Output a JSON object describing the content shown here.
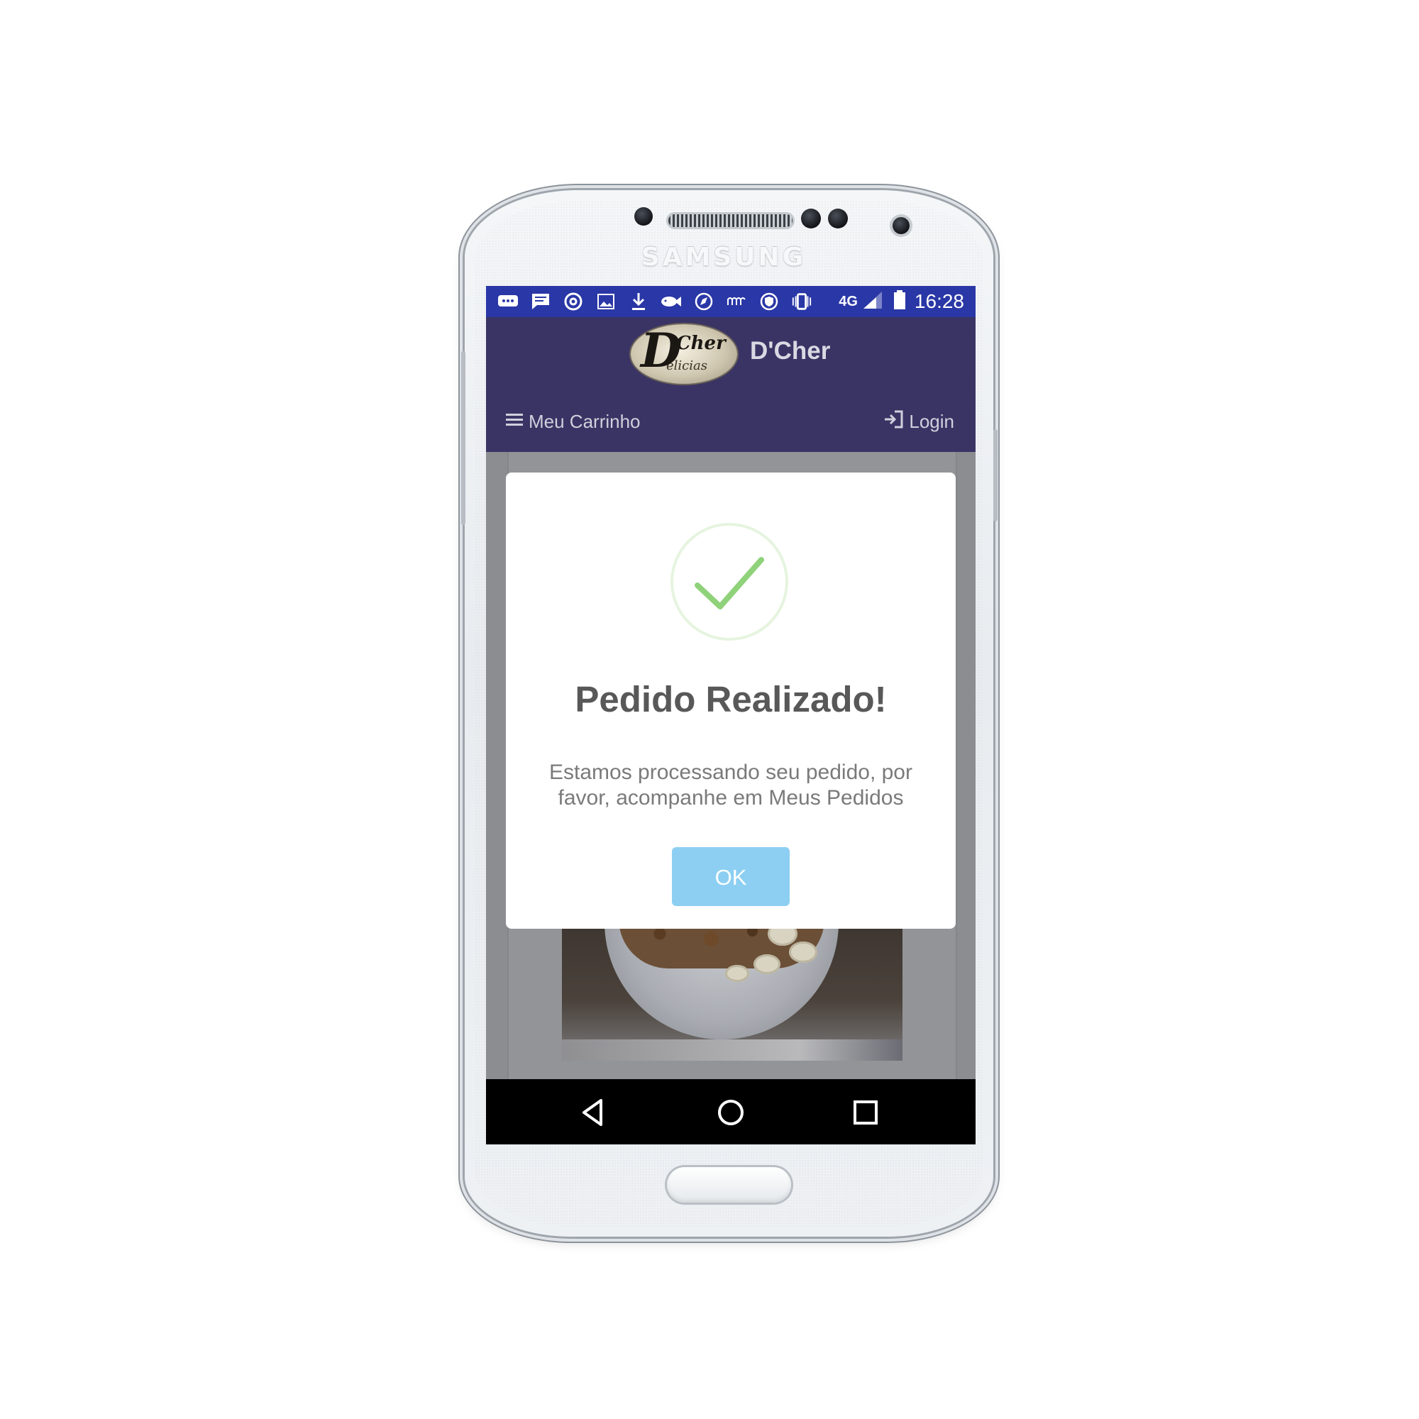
{
  "device": {
    "brand": "SAMSUNG"
  },
  "status_bar": {
    "icons": [
      "message-icon",
      "chat-icon",
      "at-icon",
      "image-icon",
      "download-icon",
      "fish-icon",
      "compass-icon",
      "wave-icon",
      "shield-icon",
      "vibrate-icon"
    ],
    "network": "4G",
    "time": "16:28",
    "color": "#2a37a6"
  },
  "app": {
    "title": "D'Cher",
    "logo_text_big": "D",
    "logo_text_top": "'Cher",
    "logo_text_bottom": "elicias",
    "header_color": "#3a3465"
  },
  "nav": {
    "menu_label": "Meu Carrinho",
    "login_label": "Login"
  },
  "modal": {
    "title": "Pedido Realizado!",
    "message": "Estamos processando seu pedido, por favor, acompanhe em Meus Pedidos",
    "ok_label": "OK",
    "success_color": "#8fd27a",
    "button_color": "#8ccff2"
  },
  "system_nav": {
    "icons": [
      "back-icon",
      "home-icon",
      "recents-icon"
    ]
  }
}
